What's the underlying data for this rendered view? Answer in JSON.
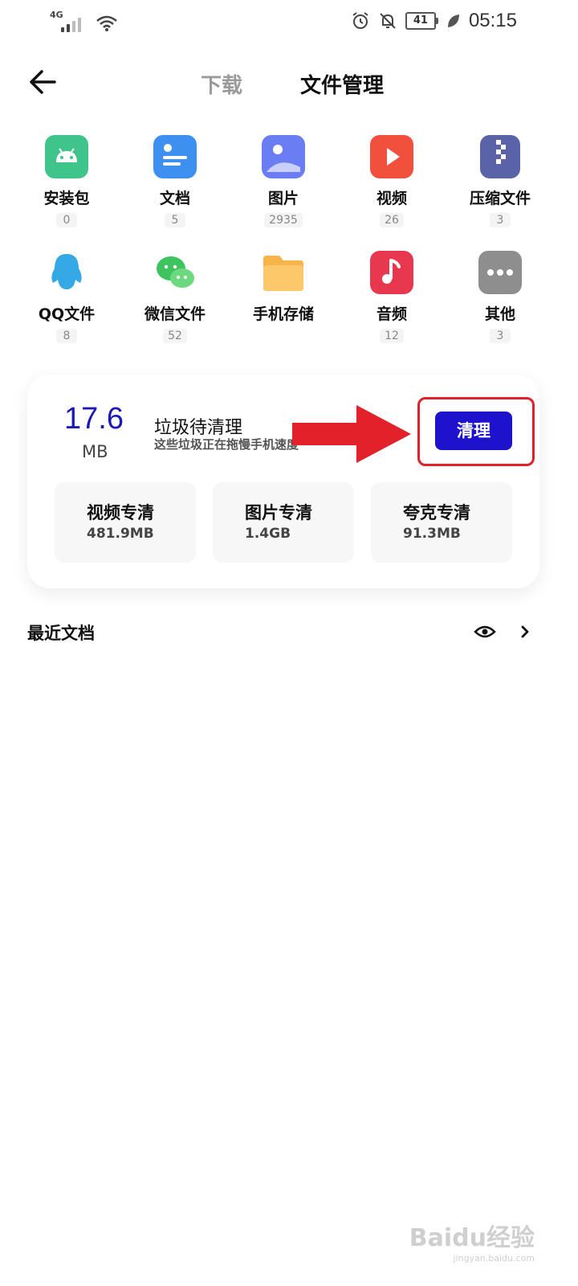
{
  "status_bar": {
    "network": "4G",
    "battery": "41",
    "time": "05:15"
  },
  "header": {
    "tab_download": "下载",
    "tab_files": "文件管理"
  },
  "categories": [
    {
      "label": "安装包",
      "count": "0",
      "icon": "android-icon",
      "color": "#3fc48c"
    },
    {
      "label": "文档",
      "count": "5",
      "icon": "document-icon",
      "color": "#3d8ff0"
    },
    {
      "label": "图片",
      "count": "2935",
      "icon": "image-icon",
      "color": "#6b7df2"
    },
    {
      "label": "视频",
      "count": "26",
      "icon": "video-icon",
      "color": "#f0503c"
    },
    {
      "label": "压缩文件",
      "count": "3",
      "icon": "zip-icon",
      "color": "#5a63a8"
    },
    {
      "label": "QQ文件",
      "count": "8",
      "icon": "qq-icon",
      "color": "#35a8e6"
    },
    {
      "label": "微信文件",
      "count": "52",
      "icon": "wechat-icon",
      "color": "#3ec45e"
    },
    {
      "label": "手机存储",
      "count": "",
      "icon": "folder-icon",
      "color": "#f7b44a"
    },
    {
      "label": "音频",
      "count": "12",
      "icon": "music-icon",
      "color": "#e8384f"
    },
    {
      "label": "其他",
      "count": "3",
      "icon": "more-icon",
      "color": "#8e8e8e"
    }
  ],
  "cleanup": {
    "size": "17.6",
    "unit": "MB",
    "title": "垃圾待清理",
    "subtitle": "这些垃圾正在拖慢手机速度",
    "button": "清理",
    "highlight_color": "#e0202a",
    "tiles": [
      {
        "title": "视频专清",
        "size": "481.9MB"
      },
      {
        "title": "图片专清",
        "size": "1.4GB"
      },
      {
        "title": "夸克专清",
        "size": "91.3MB"
      }
    ]
  },
  "recent": {
    "title": "最近文档"
  },
  "watermark": {
    "main": "Baidu经验",
    "sub": "jingyan.baidu.com"
  }
}
